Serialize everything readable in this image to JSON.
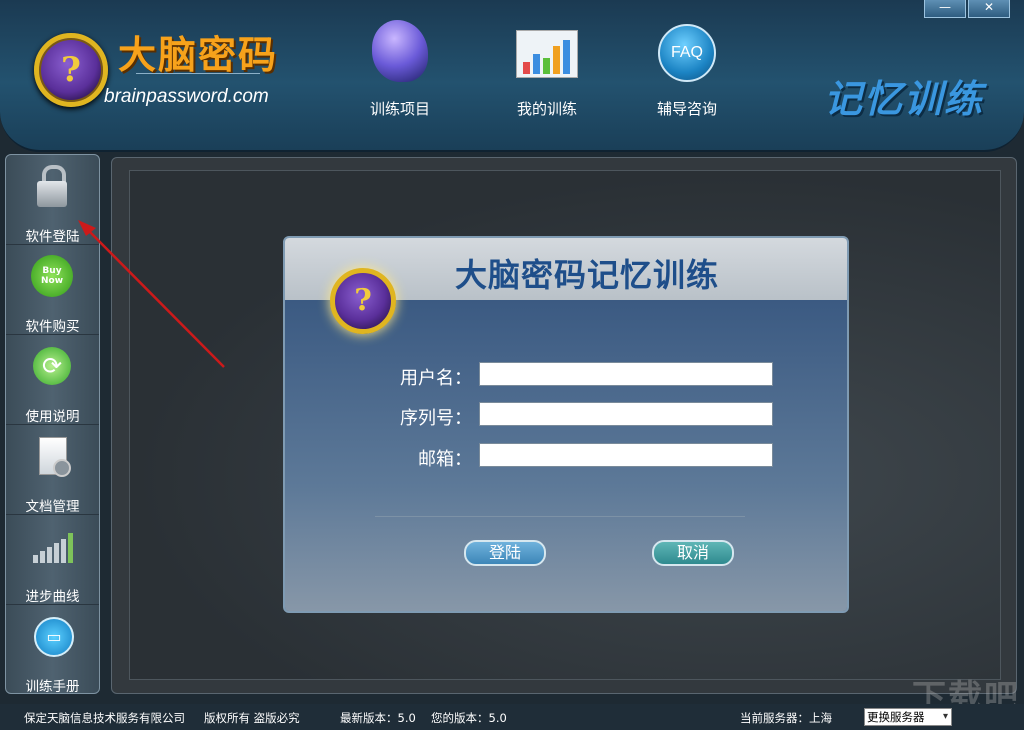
{
  "window": {
    "minimize_glyph": "—",
    "close_glyph": "✕"
  },
  "brand": {
    "logo_glyph": "?",
    "name": "大脑密码",
    "url": "brainpassword.com"
  },
  "nav": [
    {
      "label": "训练项目",
      "icon": "brain-head-icon"
    },
    {
      "label": "我的训练",
      "icon": "bar-chart-icon"
    },
    {
      "label": "辅导咨询",
      "icon": "faq-icon",
      "icon_text": "FAQ"
    }
  ],
  "header_title": "记忆训练",
  "sidebar": [
    {
      "label": "软件登陆",
      "icon": "lock-users-icon"
    },
    {
      "label": "软件购买",
      "icon": "buy-now-icon",
      "icon_text": "Buy Now"
    },
    {
      "label": "使用说明",
      "icon": "refresh-icon"
    },
    {
      "label": "文档管理",
      "icon": "document-gear-icon"
    },
    {
      "label": "进步曲线",
      "icon": "progress-bars-icon"
    },
    {
      "label": "训练手册",
      "icon": "book-icon"
    }
  ],
  "dialog": {
    "logo_glyph": "?",
    "title": "大脑密码记忆训练",
    "fields": [
      {
        "label": "用户名：",
        "value": ""
      },
      {
        "label": "序列号：",
        "value": ""
      },
      {
        "label": "邮箱：",
        "value": ""
      }
    ],
    "login_label": "登陆",
    "cancel_label": "取消"
  },
  "status": {
    "company": "保定天脑信息技术服务有限公司",
    "rights": "版权所有 盗版必究",
    "latest_version": "最新版本：5.0",
    "your_version": "您的版本：5.0",
    "current_server": "当前服务器：上海",
    "change_server": "更换服务器"
  },
  "colors": {
    "header_bg": "#23526f",
    "brand_orange": "#f7a21b",
    "title_blue": "#1e4e8a",
    "memory_title_blue": "#3a97e0",
    "annotation_arrow": "#cc1a1a"
  }
}
